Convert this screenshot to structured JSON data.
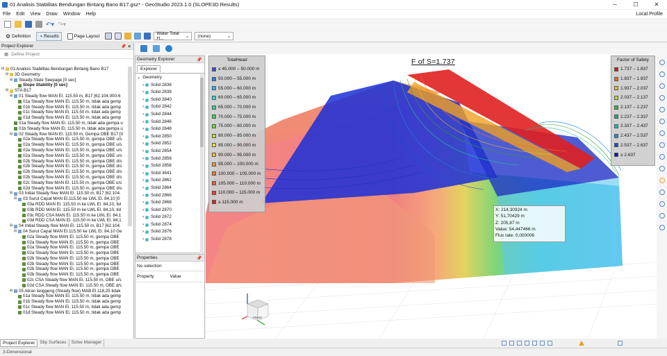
{
  "window": {
    "title": "01 Analisis Stabilitas Bendungan Bintang Bano B17.gsz* - GeoStudio 2023.1.0 (SLOPE3D Results)"
  },
  "menu": {
    "items": [
      "File",
      "Edit",
      "View",
      "Draw",
      "Window",
      "Help"
    ],
    "profile": "Local Profile"
  },
  "toolbar2": {
    "definition": "Definition",
    "results": "Results",
    "page_layout": "Page Layout",
    "result_select": "Water Total H...",
    "none_select": "(none)"
  },
  "project_explorer": {
    "title": "Project Explorer",
    "define_project": "Define Project",
    "tree": [
      {
        "indent": 0,
        "icon": "f",
        "text": "01 Analisis Stabilitas Bendungan Bintang Bano B17"
      },
      {
        "indent": 1,
        "icon": "f",
        "text": "3D Geometry"
      },
      {
        "indent": 2,
        "icon": "s",
        "text": "Steady-State Seepage [0 sec]"
      },
      {
        "indent": 3,
        "icon": "a",
        "text": "Slope Stability [0 sec]",
        "bold": true
      },
      {
        "indent": 1,
        "icon": "f",
        "text": "STA B17"
      },
      {
        "indent": 2,
        "icon": "s",
        "text": "01 Steady flow MAN El. 115.50 m, B17 [62.104.000-6"
      },
      {
        "indent": 3,
        "icon": "a",
        "text": "01a Steady flow MAN El. 115.50 m, tidak ada gemp"
      },
      {
        "indent": 3,
        "icon": "a",
        "text": "01b Steady flow MAN El. 115.50 m, tidak ada gemp"
      },
      {
        "indent": 3,
        "icon": "a",
        "text": "01c Steady flow MAN El. 115.50 m, tidak ada gemp"
      },
      {
        "indent": 3,
        "icon": "a",
        "text": "01d Steady flow MAN El. 115.50 m, tidak ada gemp"
      },
      {
        "indent": 2,
        "icon": "a",
        "text": "01a Steady flow MAN El. 115.50 m, tidak ada gempa u"
      },
      {
        "indent": 2,
        "icon": "a",
        "text": "01b Steady flow MAN El. 115.50 m, tidak ada gempa u"
      },
      {
        "indent": 2,
        "icon": "s",
        "text": "02 Steady flow MAN El. 115.50 m, Gempa OBE B17 [0"
      },
      {
        "indent": 3,
        "icon": "a",
        "text": "02a Steady flow MAN El. 115.50 m, gempa OBE u/s"
      },
      {
        "indent": 3,
        "icon": "a",
        "text": "02a Steady flow MAN El. 115.50 m, gempa OBE u/s"
      },
      {
        "indent": 3,
        "icon": "a",
        "text": "02a Steady flow MAN El. 115.50 m, gempa OBE u/s"
      },
      {
        "indent": 3,
        "icon": "a",
        "text": "02a Steady flow MAN El. 115.50 m, gempa OBE u/s"
      },
      {
        "indent": 3,
        "icon": "a",
        "text": "02b Steady flow MAN El. 115.50 m, gempa OBE d/s"
      },
      {
        "indent": 3,
        "icon": "a",
        "text": "02b Steady flow MAN El. 115.50 m, gempa OBE d/s"
      },
      {
        "indent": 3,
        "icon": "a",
        "text": "02b Steady flow MAN El. 115.50 m, gempa OBE d/s"
      },
      {
        "indent": 3,
        "icon": "a",
        "text": "02b Steady flow MAN El. 115.50 m, gempa OBE d/s"
      },
      {
        "indent": 3,
        "icon": "a",
        "text": "02c Steady flow MAN El. 115.50 m, gempa OBE u/s"
      },
      {
        "indent": 3,
        "icon": "a",
        "text": "02d Steady flow MAN El. 115.50 m, gempa OBE d/s"
      },
      {
        "indent": 2,
        "icon": "s",
        "text": "03 Initial Steady flow MAN El. 115.50 m, B17 [62.104."
      },
      {
        "indent": 3,
        "icon": "s",
        "text": "03 Surut Cepat MAN El.115,50 ke LWL El. 84,10 [0"
      },
      {
        "indent": 4,
        "icon": "a",
        "text": "03a RDD MAN El. 115.50 m ke LWL El. 84,10, tid"
      },
      {
        "indent": 4,
        "icon": "a",
        "text": "03b RDD MAN El. 115.50 m ke LWL El. 84,10, tid"
      },
      {
        "indent": 4,
        "icon": "a",
        "text": "03c RDD CSA MAN El. 115.50 m ke LWL El. 84,1"
      },
      {
        "indent": 4,
        "icon": "a",
        "text": "03d RDD CSA MAN El. 115.50 m ke LWL El. 84,1"
      },
      {
        "indent": 2,
        "icon": "s",
        "text": "04 Initial Steady flow MAN El. 115.50 m, B17 [62.104."
      },
      {
        "indent": 3,
        "icon": "s",
        "text": "04 Surut Cepat MAN El.115,50 ke LWL El. 84,10 Ge"
      },
      {
        "indent": 4,
        "icon": "a",
        "text": "02a Steady flow MAN El. 115.50 m, gempa OBE"
      },
      {
        "indent": 4,
        "icon": "a",
        "text": "02a Steady flow MAN El. 115.50 m, gempa OBE"
      },
      {
        "indent": 4,
        "icon": "a",
        "text": "02a Steady flow MAN El. 115.50 m, gempa OBE"
      },
      {
        "indent": 4,
        "icon": "a",
        "text": "02a Steady flow MAN El. 115.50 m, gempa OBE"
      },
      {
        "indent": 4,
        "icon": "a",
        "text": "02b Steady flow MAN El. 115.50 m, gempa OBE"
      },
      {
        "indent": 4,
        "icon": "a",
        "text": "02b Steady flow MAN El. 115.50 m, gempa OBE"
      },
      {
        "indent": 4,
        "icon": "a",
        "text": "02b Steady flow MAN El. 115.50 m, gempa OBE"
      },
      {
        "indent": 4,
        "icon": "a",
        "text": "02b Steady flow MAN El. 115.50 m, gempa OBE"
      },
      {
        "indent": 4,
        "icon": "a",
        "text": "02c CSA Steady flow MAN El. 115.50 m, OBE u/s"
      },
      {
        "indent": 4,
        "icon": "a",
        "text": "02d CSA Steady flow MAN El. 115.50 m, OBE d/s"
      },
      {
        "indent": 2,
        "icon": "s",
        "text": "05 Aliran langgeng (Steady flow) MAB El.118,25 tidak"
      },
      {
        "indent": 3,
        "icon": "a",
        "text": "01a Steady flow MAN El. 115.50 m, tidak ada gemp"
      },
      {
        "indent": 3,
        "icon": "a",
        "text": "01b Steady flow MAN El. 115.50 m, tidak ada gemp"
      },
      {
        "indent": 3,
        "icon": "a",
        "text": "01c Steady flow MAN El. 115.50 m, tidak ada gemp"
      },
      {
        "indent": 3,
        "icon": "a",
        "text": "01d Steady flow MAN El. 115.50 m, tidak ada gemp"
      }
    ]
  },
  "bottom_tabs": [
    "Project Explorer",
    "Slip Surfaces",
    "Solve Manager"
  ],
  "status": {
    "text": "3-Dimensional"
  },
  "geometry_explorer": {
    "title": "Geometry Explorer",
    "tab": "Explorer",
    "root": "Geometry",
    "items": [
      "Solid 2836",
      "Solid 2838",
      "Solid 2840",
      "Solid 2842",
      "Solid 2844",
      "Solid 2846",
      "Solid 2848",
      "Solid 2850",
      "Solid 2852",
      "Solid 2854",
      "Solid 2856",
      "Solid 2858",
      "Solid 3641",
      "Solid 2862",
      "Solid 2864",
      "Solid 2866",
      "Solid 2868",
      "Solid 2870",
      "Solid 2872",
      "Solid 2874",
      "Solid 2876",
      "Solid 2878"
    ]
  },
  "properties": {
    "title": "Properties",
    "no_selection": "No selection",
    "col_property": "Property",
    "col_value": "Value"
  },
  "viewport": {
    "fos_label": "F of S=1.737",
    "totalhead_legend": {
      "title": "TotalHead",
      "entries": [
        {
          "label": "≤ 45.000 – 50.000 m",
          "color": "#3b49e6"
        },
        {
          "label": "50.000 – 55.000 m",
          "color": "#2f7fe8"
        },
        {
          "label": "55.000 – 60.000 m",
          "color": "#2fb4e8"
        },
        {
          "label": "60.000 – 65.000 m",
          "color": "#2fd8d4"
        },
        {
          "label": "65.000 – 70.000 m",
          "color": "#2fd89a"
        },
        {
          "label": "70.000 – 75.000 m",
          "color": "#3fd860"
        },
        {
          "label": "75.000 – 80.000 m",
          "color": "#7ed83a"
        },
        {
          "label": "80.000 – 85.000 m",
          "color": "#b8e030"
        },
        {
          "label": "85.000 – 90.000 m",
          "color": "#e6e030"
        },
        {
          "label": "90.000 – 95.000 m",
          "color": "#f0c030"
        },
        {
          "label": "95.000 – 100.000 m",
          "color": "#f09a30"
        },
        {
          "label": "100.000 – 105.000 m",
          "color": "#f07a30"
        },
        {
          "label": "105.000 – 110.000 m",
          "color": "#f05a30"
        },
        {
          "label": "110.000 – 115.000 m",
          "color": "#e83a30"
        },
        {
          "label": "≥ 115.000 m",
          "color": "#d82020"
        }
      ]
    },
    "fos_legend": {
      "title": "Factor of Safety",
      "entries": [
        {
          "label": "1.737 – 1.837",
          "color": "#e01010"
        },
        {
          "label": "1.837 – 1.937",
          "color": "#f07010"
        },
        {
          "label": "1.937 – 2.037",
          "color": "#f0c010"
        },
        {
          "label": "2.037 – 2.137",
          "color": "#c8e010"
        },
        {
          "label": "2.137 – 2.237",
          "color": "#30c030"
        },
        {
          "label": "2.237 – 2.337",
          "color": "#10b080"
        },
        {
          "label": "2.337 – 2.437",
          "color": "#10c0c0"
        },
        {
          "label": "2.437 – 2.537",
          "color": "#1090e0"
        },
        {
          "label": "2.537 – 2.637",
          "color": "#1050e0"
        },
        {
          "label": "≥ 2.637",
          "color": "#1010c0"
        }
      ]
    },
    "probe": {
      "x": "X: 214,30924 m",
      "y": "Y: 51,70429 m",
      "z": "Z: 205,87 m",
      "value": "Value: 54,447466 m",
      "flux": "Flux rate: 0,000006"
    },
    "cube_label": "FRONT"
  }
}
